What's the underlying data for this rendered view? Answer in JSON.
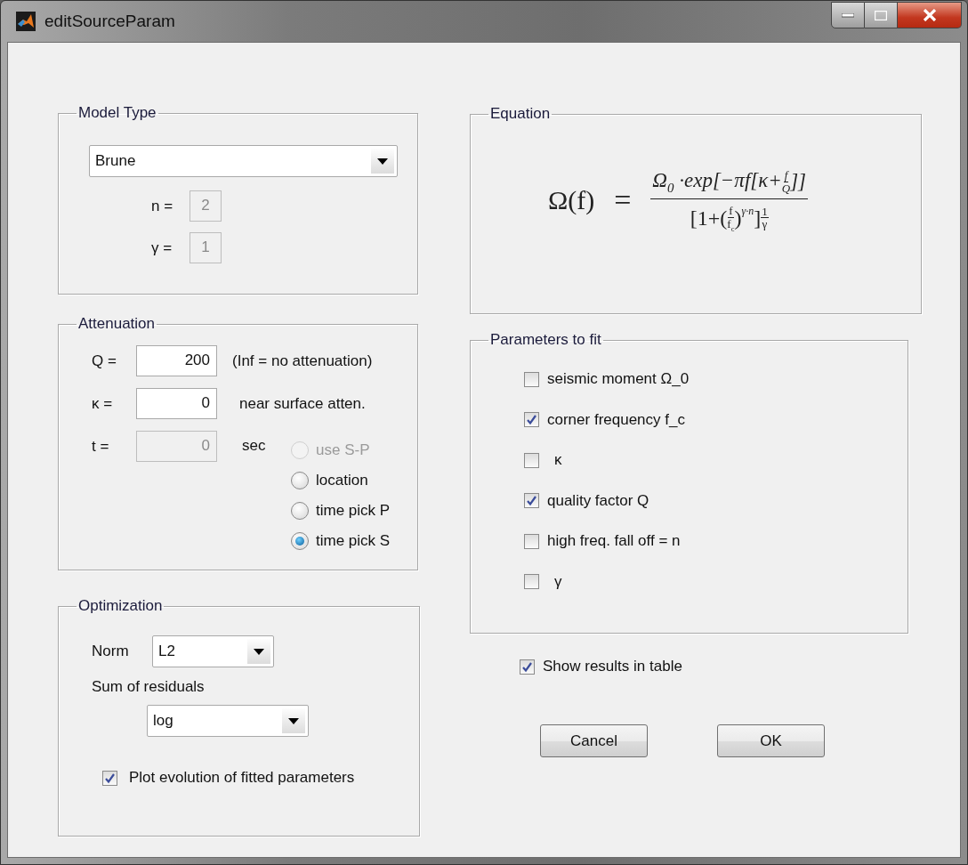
{
  "window": {
    "title": "editSourceParam"
  },
  "model_type": {
    "title": "Model Type",
    "model": {
      "value": "Brune"
    },
    "params": [
      {
        "label": "n =",
        "value": "2",
        "disabled": true
      },
      {
        "label": "γ =",
        "value": "1",
        "disabled": true
      }
    ]
  },
  "attenuation": {
    "title": "Attenuation",
    "fields": [
      {
        "label": "Q =",
        "value": "200",
        "note": "(Inf = no attenuation)",
        "disabled": false
      },
      {
        "label": "κ =",
        "value": "0",
        "note": "near surface atten.",
        "disabled": false
      },
      {
        "label": "t =",
        "value": "0",
        "note": "sec",
        "disabled": true
      }
    ],
    "time_source": [
      {
        "label": "use S-P",
        "selected": false,
        "disabled": true
      },
      {
        "label": "location",
        "selected": false,
        "disabled": false
      },
      {
        "label": "time pick P",
        "selected": false,
        "disabled": false
      },
      {
        "label": "time pick S",
        "selected": true,
        "disabled": false
      }
    ]
  },
  "optimization": {
    "title": "Optimization",
    "norm": {
      "label": "Norm",
      "value": "L2"
    },
    "residuals": {
      "label": "Sum of residuals",
      "value": "log"
    },
    "plot_evolution": {
      "label": "Plot evolution of fitted parameters",
      "checked": true
    }
  },
  "equation": {
    "title": "Equation",
    "lhs": "Ω(f)",
    "equals": "=",
    "numerator": {
      "before": "Ω$_{0}$ ·exp[−πf[κ+",
      "frac": [
        "f",
        "Q"
      ],
      "after": "]]"
    },
    "denominator": {
      "before": "[1+(",
      "frac": [
        "f",
        "f$_{c}$"
      ],
      "after": ")",
      "power": "γ·n",
      "close": "]",
      "exponent": [
        "1",
        "γ"
      ]
    }
  },
  "parameters_to_fit": {
    "title": "Parameters to fit",
    "items": [
      {
        "label": "seismic moment Ω_0",
        "checked": false
      },
      {
        "label": "corner frequency f_c",
        "checked": true
      },
      {
        "label": "κ",
        "checked": false
      },
      {
        "label": "quality factor Q",
        "checked": true
      },
      {
        "label": "high freq. fall off = n",
        "checked": false
      },
      {
        "label": "γ",
        "checked": false
      }
    ]
  },
  "show_results": {
    "label": "Show results in table",
    "checked": true
  },
  "buttons": [
    "Cancel",
    "OK"
  ]
}
